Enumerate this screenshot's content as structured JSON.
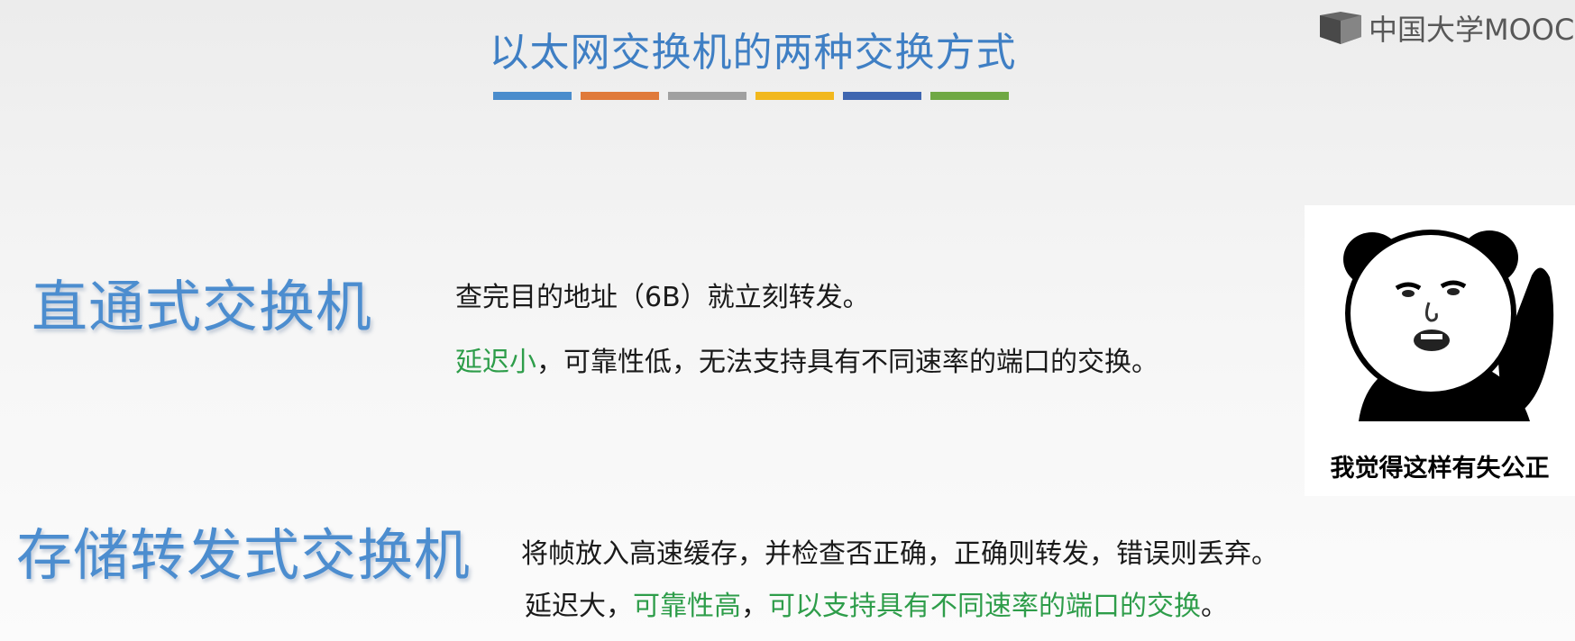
{
  "slide": {
    "title": "以太网交换机的两种交换方式",
    "title_bar_colors": [
      "#4a8ccc",
      "#e07a3a",
      "#a0a0a0",
      "#f2b81e",
      "#3f66b0",
      "#6fa844"
    ]
  },
  "logo": {
    "text": "中国大学MOOC",
    "icon": "mooc-book-icon"
  },
  "cut_through": {
    "heading": "直通式交换机",
    "line1": "查完目的地址（6B）就立刻转发。",
    "line2_green": "延迟小",
    "line2_rest": "，可靠性低，无法支持具有不同速率的端口的交换。"
  },
  "store_forward": {
    "heading": "存储转发式交换机",
    "line1": "将帧放入高速缓存，并检查否正确，正确则转发，错误则丢弃。",
    "line2_a": "延迟大，",
    "line2_b_green": "可靠性高",
    "line2_c": "，",
    "line2_d_green": "可以支持具有不同速率的端口的交换",
    "line2_e": "。"
  },
  "meme": {
    "caption": "我觉得这样有失公正",
    "icon": "panda-meme-face"
  },
  "colors": {
    "heading_blue": "#4c8dcf",
    "title_blue": "#3f7fc4",
    "highlight_green": "#2e9d4a"
  }
}
